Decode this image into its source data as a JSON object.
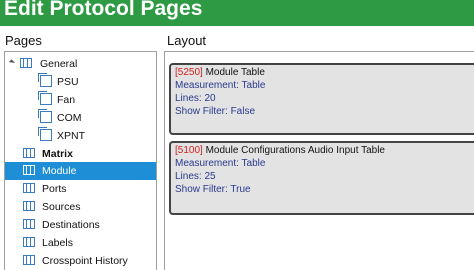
{
  "header": {
    "title": "Edit Protocol Pages",
    "bg_color": "#2e9b44"
  },
  "pages_panel": {
    "label": "Pages",
    "selected_color": "#1e8fd6",
    "items": [
      {
        "label": "General",
        "icon": "table-icon",
        "expanded": true,
        "level": 0,
        "bold": false,
        "selected": false
      },
      {
        "label": "PSU",
        "icon": "page-icon",
        "level": 1,
        "bold": false,
        "selected": false
      },
      {
        "label": "Fan",
        "icon": "page-icon",
        "level": 1,
        "bold": false,
        "selected": false
      },
      {
        "label": "COM",
        "icon": "page-icon",
        "level": 1,
        "bold": false,
        "selected": false
      },
      {
        "label": "XPNT",
        "icon": "page-icon",
        "level": 1,
        "bold": false,
        "selected": false
      },
      {
        "label": "Matrix",
        "icon": "table-icon",
        "level": 0,
        "bold": true,
        "selected": false
      },
      {
        "label": "Module",
        "icon": "table-icon",
        "level": 0,
        "bold": false,
        "selected": true
      },
      {
        "label": "Ports",
        "icon": "table-icon",
        "level": 0,
        "bold": false,
        "selected": false
      },
      {
        "label": "Sources",
        "icon": "table-icon",
        "level": 0,
        "bold": false,
        "selected": false
      },
      {
        "label": "Destinations",
        "icon": "table-icon",
        "level": 0,
        "bold": false,
        "selected": false
      },
      {
        "label": "Labels",
        "icon": "table-icon",
        "level": 0,
        "bold": false,
        "selected": false
      },
      {
        "label": "Crosspoint History",
        "icon": "table-icon",
        "level": 0,
        "bold": false,
        "selected": false
      }
    ]
  },
  "layout_panel": {
    "label": "Layout",
    "cards": [
      {
        "pid": "[5250]",
        "name": "Module Table",
        "measurement": "Measurement: Table",
        "lines": "Lines: 20",
        "show_filter": "Show Filter: False"
      },
      {
        "pid": "[5100]",
        "name": "Module Configurations Audio Input Table",
        "measurement": "Measurement: Table",
        "lines": "Lines: 25",
        "show_filter": "Show Filter: True"
      }
    ]
  }
}
